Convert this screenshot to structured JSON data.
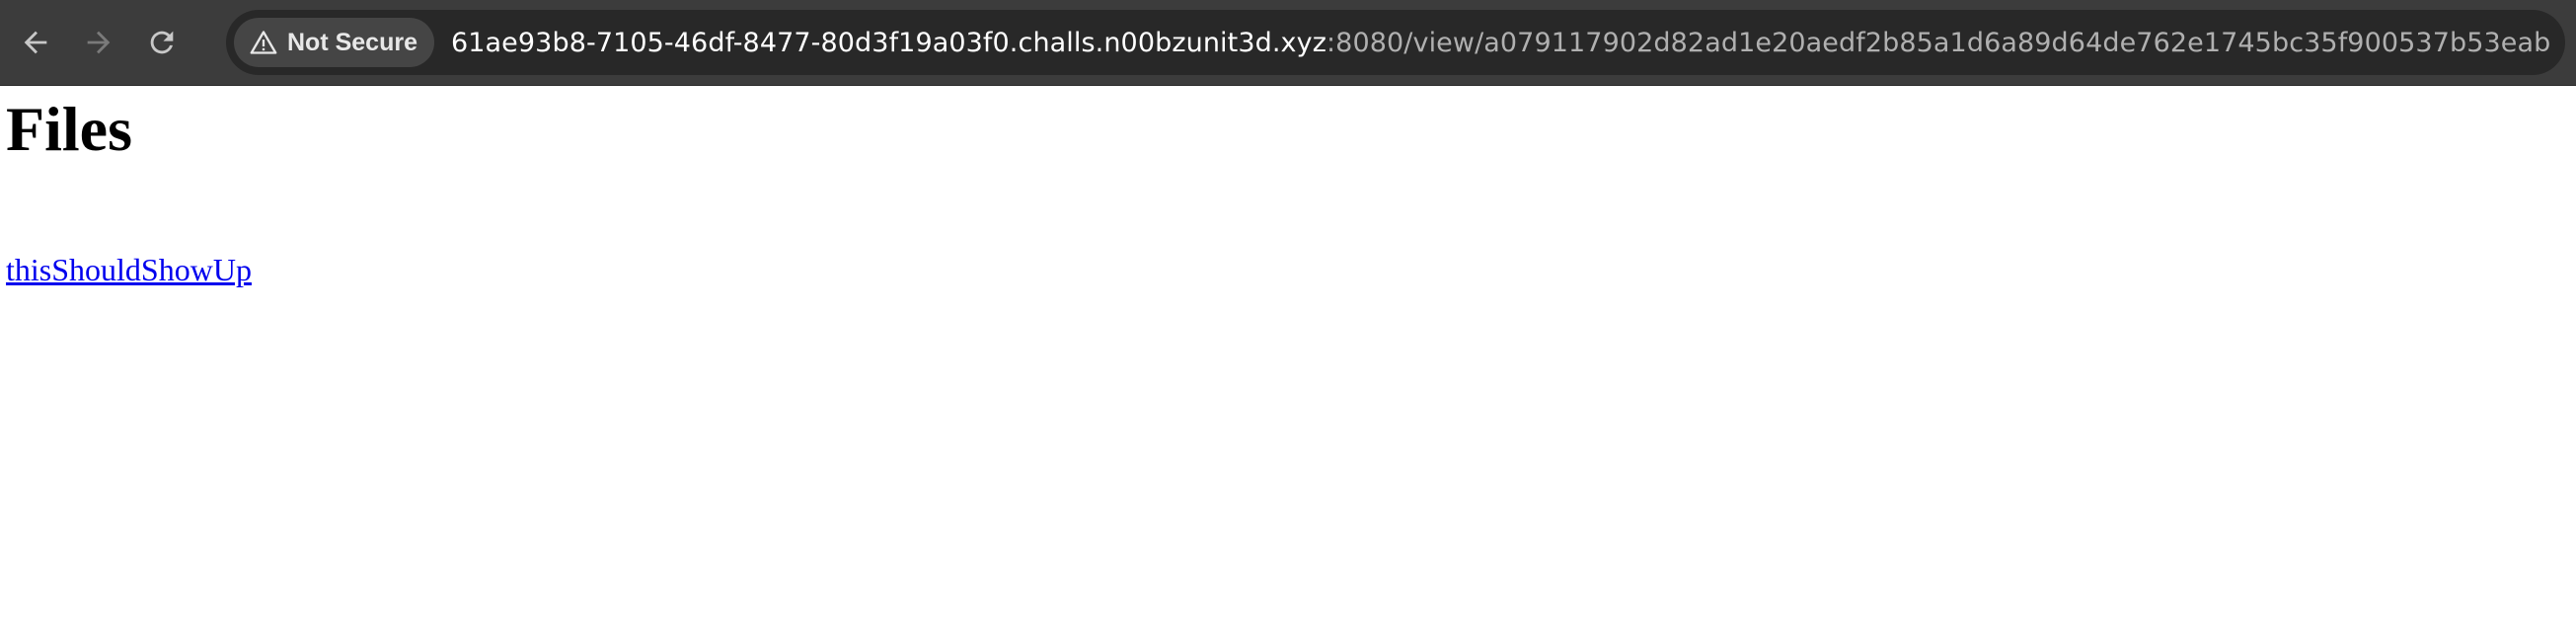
{
  "browser": {
    "security_label": "Not Secure",
    "url_host": "61ae93b8-7105-46df-8477-80d3f19a03f0.challs.n00bzunit3d.xyz",
    "url_rest": ":8080/view/a079117902d82ad1e20aedf2b85a1d6a89d64de762e1745bc35f900537b53eab",
    "back_icon": "arrow-left-icon",
    "forward_icon": "arrow-right-icon",
    "reload_icon": "reload-icon",
    "warning_icon": "warning-triangle-icon"
  },
  "page": {
    "heading": "Files",
    "files": [
      {
        "label": "thisShouldShowUp"
      }
    ]
  },
  "colors": {
    "toolbar_bg": "#3c3c3c",
    "omnibox_bg": "#282828",
    "link": "#0000ee"
  }
}
